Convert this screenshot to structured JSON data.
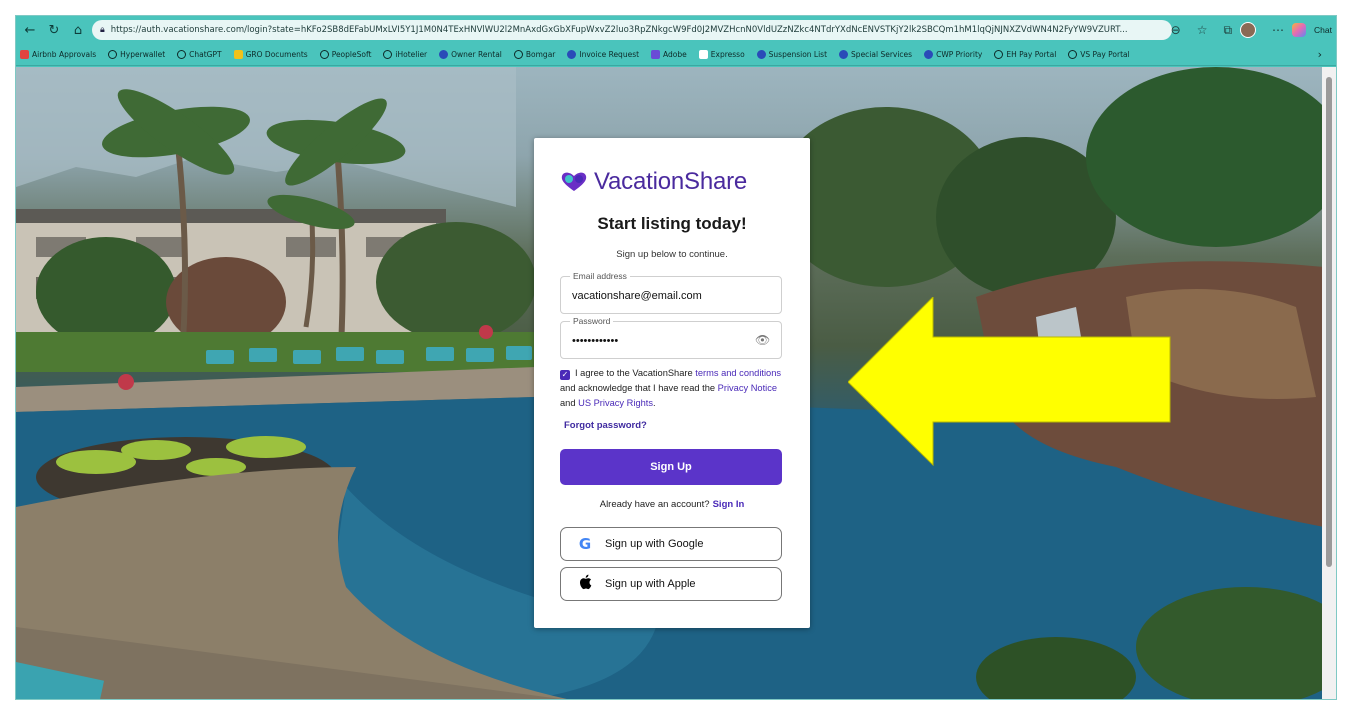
{
  "browser": {
    "url": "https://auth.vacationshare.com/login?state=hKFo2SB8dEFabUMxLVI5Y1J1M0N4TExHNVlWU2l2MnAxdGxGbXFupWxvZ2luo3RpZNkgcW9Fd0J2MVZHcnN0VldUZzNZkc4NTdrYXdNcENVSTKjY2lk2SBCQm1hM1lqQjNJNXZVdWN4N2FyYW9VZURT...",
    "chat_label": "Chat",
    "bookmarks": [
      "Airbnb Approvals",
      "Hyperwallet",
      "ChatGPT",
      "GRO Documents",
      "PeopleSoft",
      "iHotelier",
      "Owner Rental",
      "Bomgar",
      "Invoice Request",
      "Adobe",
      "Expresso",
      "Suspension List",
      "Special Services",
      "CWP Priority",
      "EH Pay Portal",
      "VS Pay Portal"
    ]
  },
  "icons": {
    "back": "back-arrow-icon",
    "refresh": "refresh-icon",
    "home": "home-icon",
    "eye": "eye-icon",
    "google": "google-icon",
    "apple": "apple-icon"
  },
  "colors": {
    "brand_purple": "#5b34c9",
    "browser_teal": "#4ac4bc",
    "annotation_yellow": "#ffff00"
  },
  "card": {
    "brand_name": "VacationShare",
    "headline": "Start listing today!",
    "subhead": "Sign up below to continue.",
    "email": {
      "label": "Email address",
      "value": "vacationshare@email.com"
    },
    "password": {
      "label": "Password",
      "value": "••••••••••••"
    },
    "agree": {
      "checked": true,
      "text_1": "I agree to the VacationShare ",
      "terms_link": "terms and conditions",
      "text_2": " and acknowledge that I have read the ",
      "privacy_link": "Privacy Notice",
      "text_3": " and ",
      "us_privacy_link": "US Privacy Rights",
      "text_4": "."
    },
    "forgot_password": "Forgot password?",
    "signup_button": "Sign Up",
    "have_account": "Already have an account?",
    "signin_link": "Sign In",
    "google_button": "Sign up with Google",
    "apple_button": "Sign up with Apple"
  }
}
